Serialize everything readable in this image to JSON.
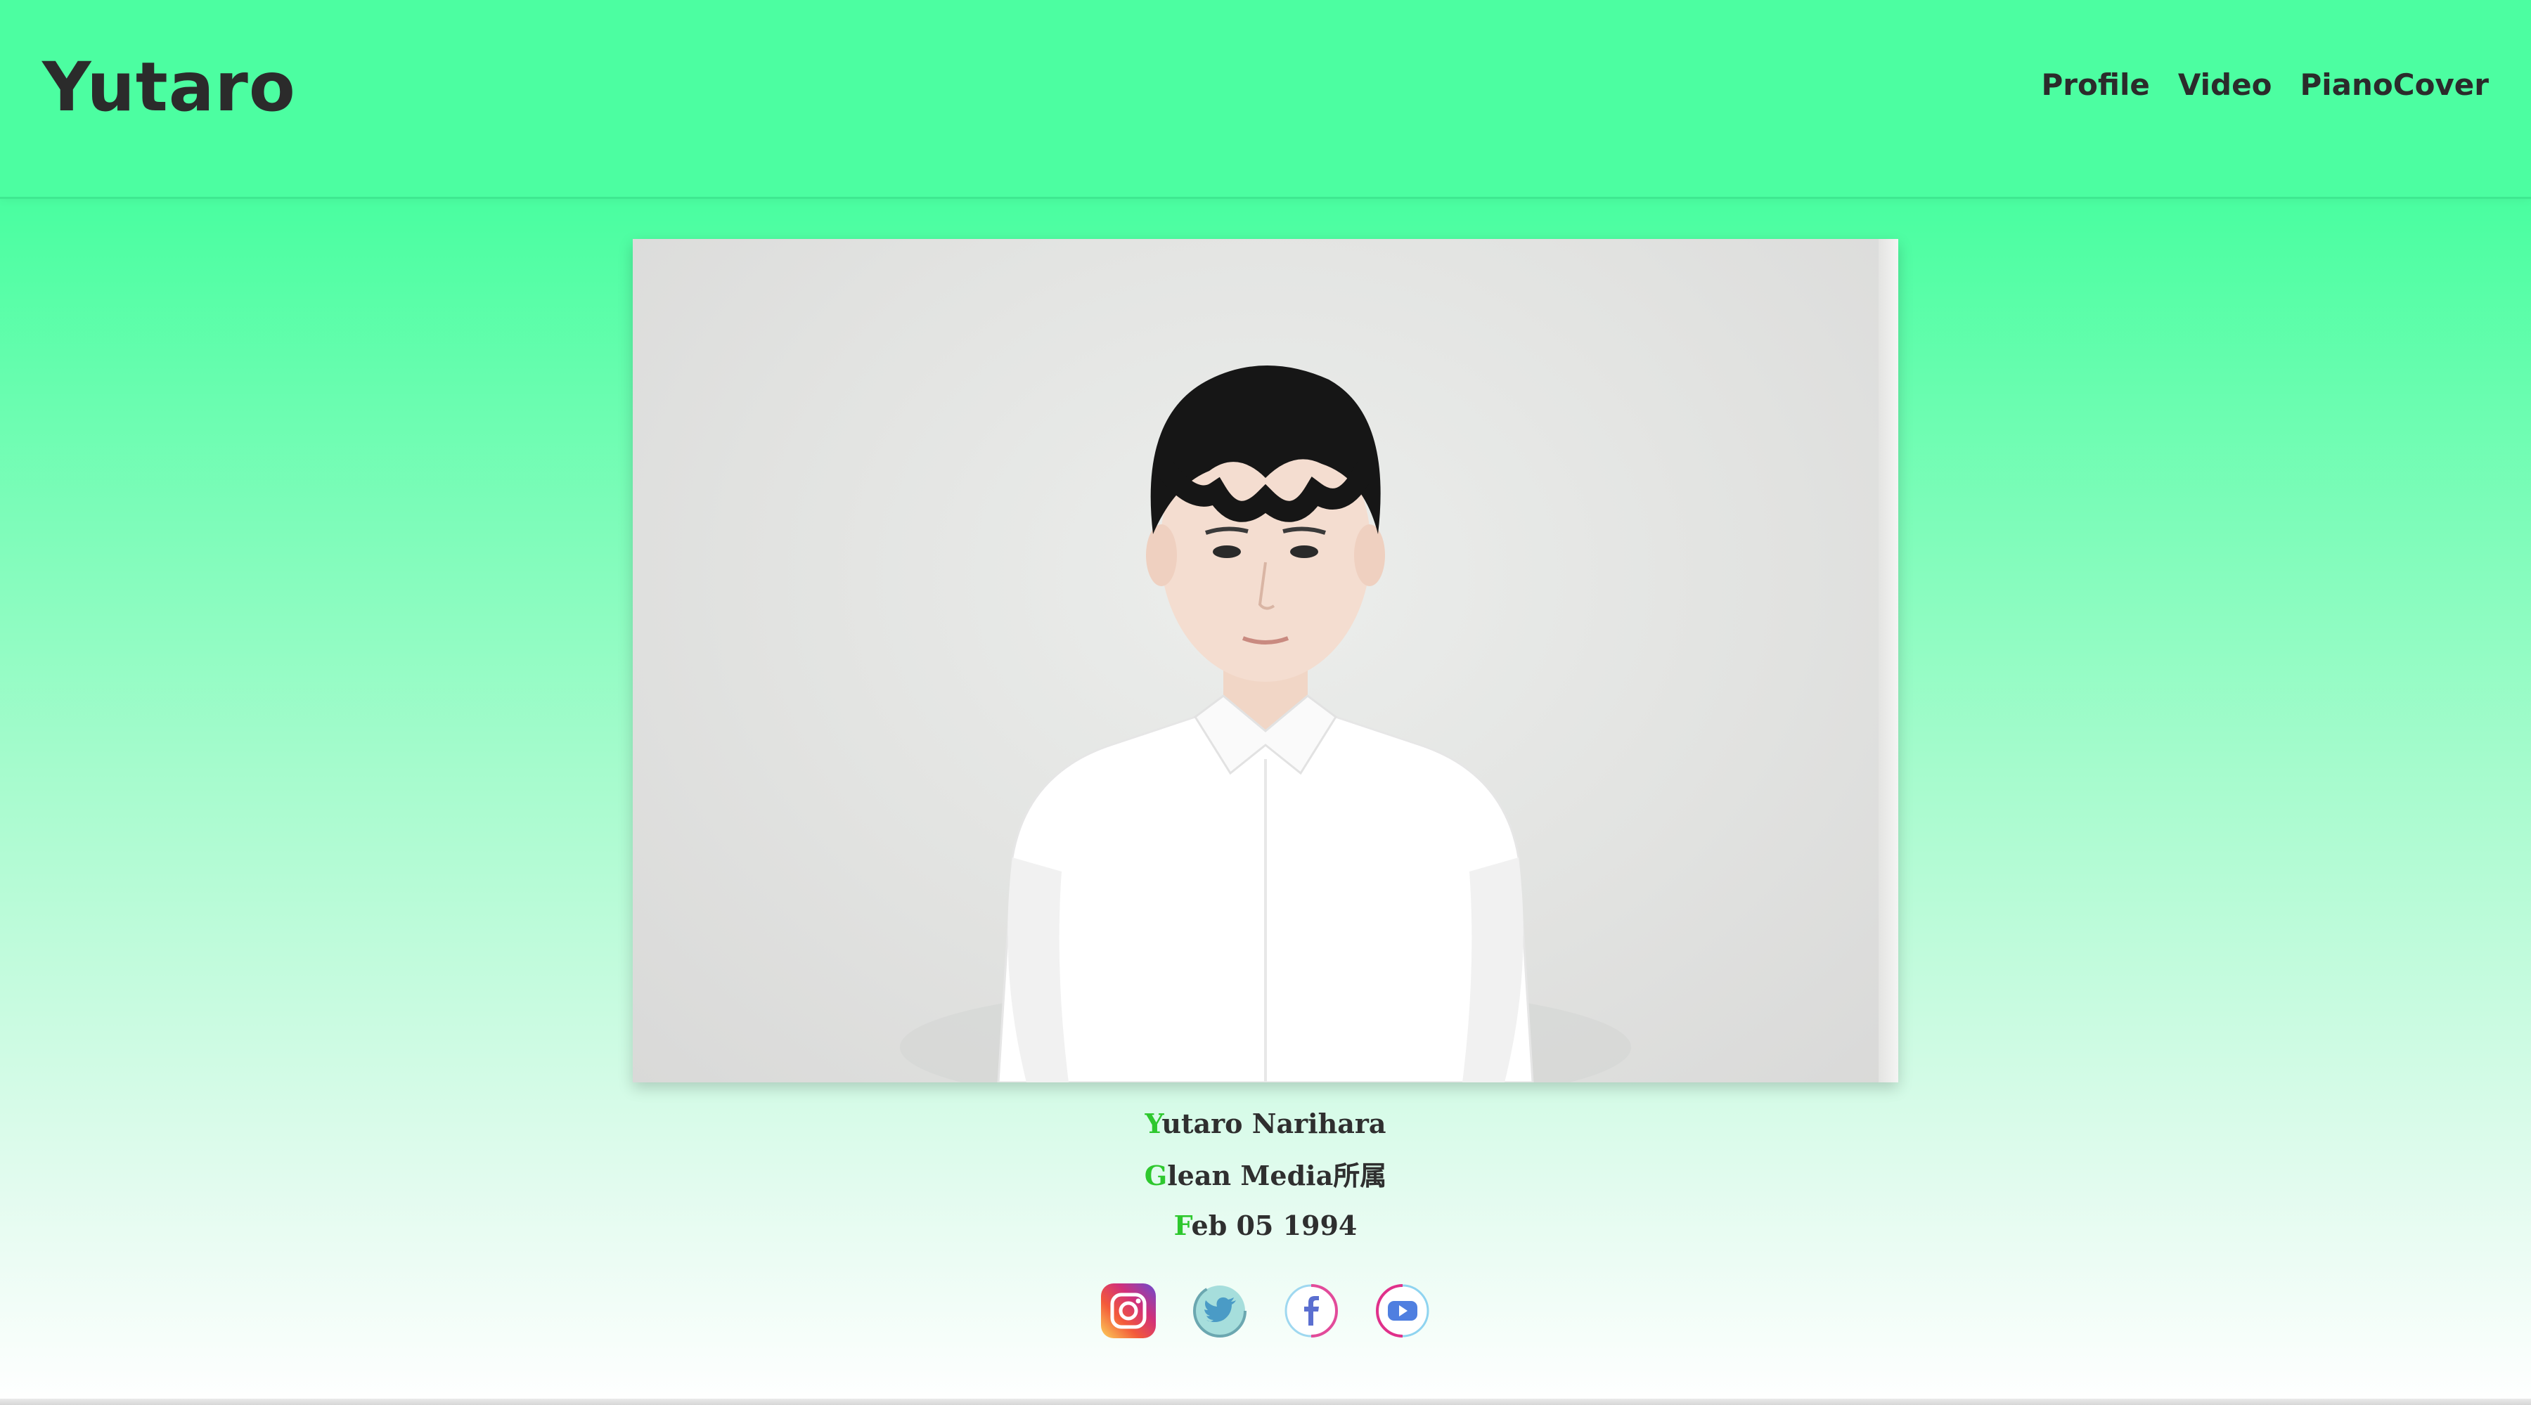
{
  "header": {
    "logo": "Yutaro",
    "nav": [
      "Profile",
      "Video",
      "PianoCover"
    ]
  },
  "photo": {
    "background_color": "#e3e4e2",
    "shirt_color": "#ffffff",
    "hair_color": "#151515"
  },
  "profile": {
    "name": {
      "initial": "Y",
      "rest": "utaro Narihara"
    },
    "agency": {
      "initial": "G",
      "rest": "lean Media所属"
    },
    "birthday": {
      "initial": "F",
      "rest": "eb 05 1994"
    }
  },
  "socials": [
    "instagram-icon",
    "twitter-icon",
    "facebook-icon",
    "youtube-icon"
  ],
  "colors": {
    "accent_green": "#4cfea1",
    "initial_green": "#2ec82e",
    "text_dark": "#2b2b2b"
  }
}
